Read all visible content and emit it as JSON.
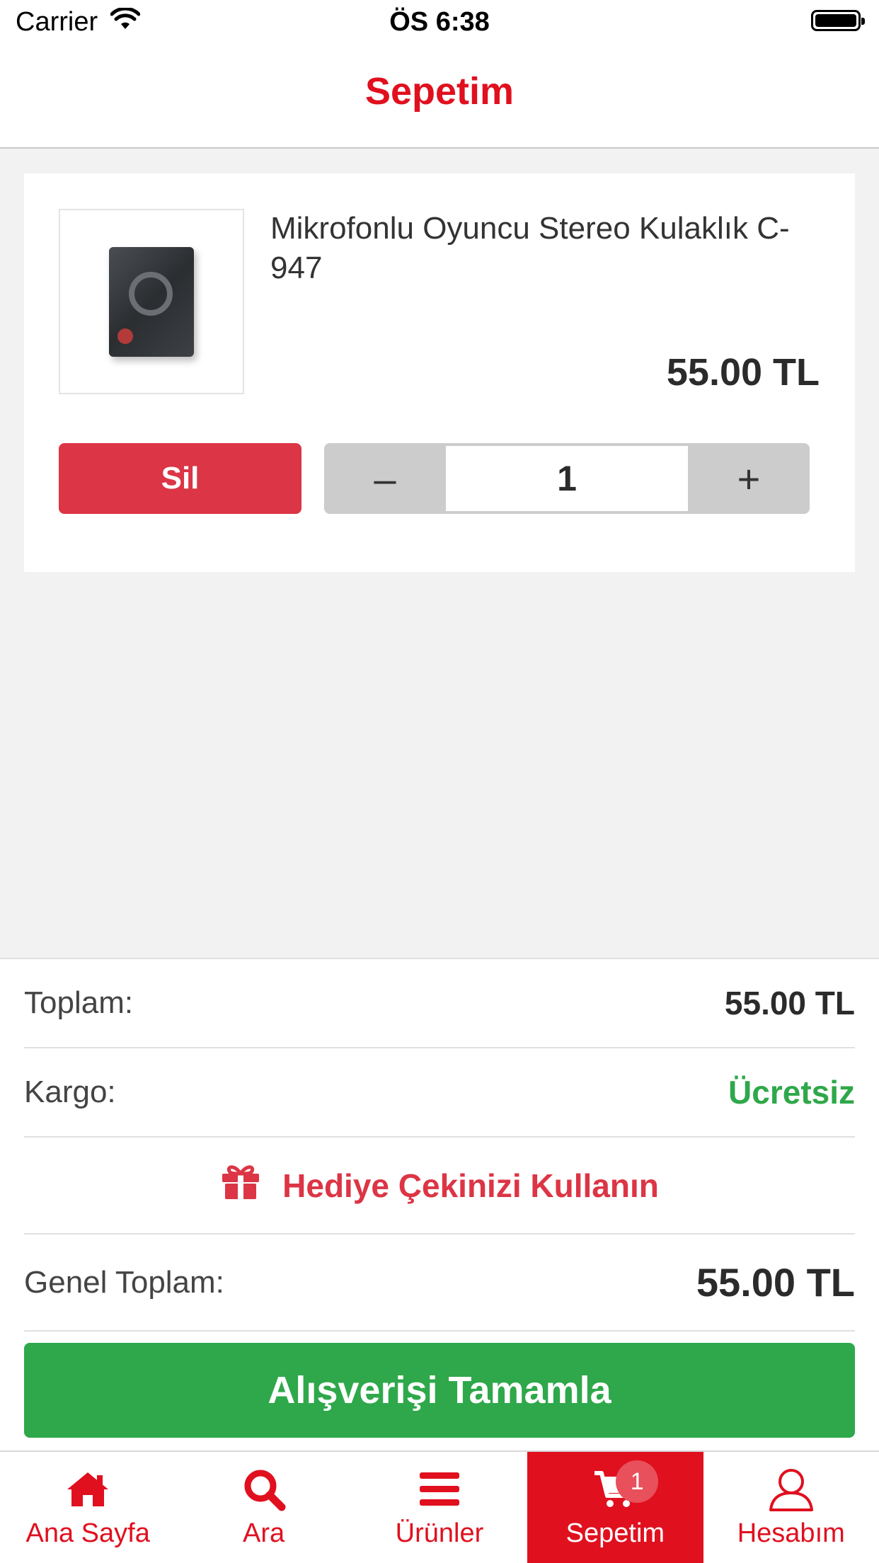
{
  "status_bar": {
    "carrier": "Carrier",
    "time": "ÖS 6:38",
    "icons": [
      "wifi-icon",
      "battery-icon"
    ]
  },
  "header": {
    "title": "Sepetim"
  },
  "cart": {
    "items": [
      {
        "name": "Mikrofonlu Oyuncu Stereo Kulaklık C-947",
        "price": "55.00 TL",
        "quantity": "1",
        "delete_label": "Sil",
        "decrement_label": "–",
        "increment_label": "+"
      }
    ]
  },
  "summary": {
    "subtotal_label": "Toplam:",
    "subtotal_value": "55.00 TL",
    "shipping_label": "Kargo:",
    "shipping_value": "Ücretsiz",
    "gift_label": "Hediye Çekinizi Kullanın",
    "grand_total_label": "Genel Toplam:",
    "grand_total_value": "55.00 TL",
    "checkout_label": "Alışverişi Tamamla"
  },
  "tab_bar": {
    "items": [
      {
        "label": "Ana Sayfa",
        "icon": "home-icon"
      },
      {
        "label": "Ara",
        "icon": "search-icon"
      },
      {
        "label": "Ürünler",
        "icon": "menu-icon"
      },
      {
        "label": "Sepetim",
        "icon": "cart-icon",
        "badge": "1",
        "active": true
      },
      {
        "label": "Hesabım",
        "icon": "user-icon"
      }
    ]
  },
  "colors": {
    "brand_red": "#e0101f",
    "delete_red": "#dc3545",
    "success_green": "#2ea84a"
  }
}
